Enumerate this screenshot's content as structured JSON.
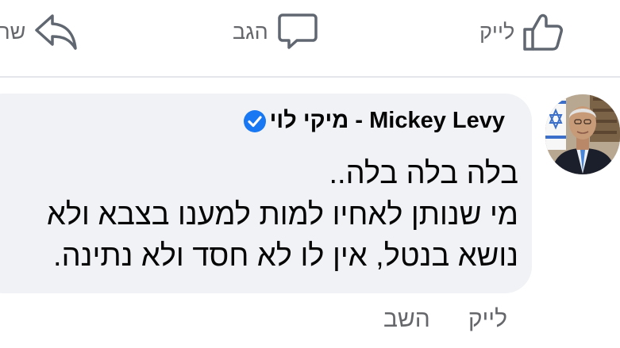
{
  "action_bar": {
    "like_label": "לייק",
    "comment_label": "הגב",
    "share_label": "שת"
  },
  "comment": {
    "author": "מיקי לוי - Mickey Levy",
    "verified": true,
    "lines": [
      "בלה בלה בלה..",
      "מי שנותן לאחיו למות למענו בצבא ולא",
      "נושא בנטל, אין לו לא חסד ולא נתינה."
    ],
    "actions": {
      "like_label": "לייק",
      "reply_label": "השב"
    }
  },
  "colors": {
    "bubble": "#f0f2f5",
    "secondary_text": "#65676b",
    "verified_badge": "#1877f2",
    "divider": "#e4e6eb"
  }
}
